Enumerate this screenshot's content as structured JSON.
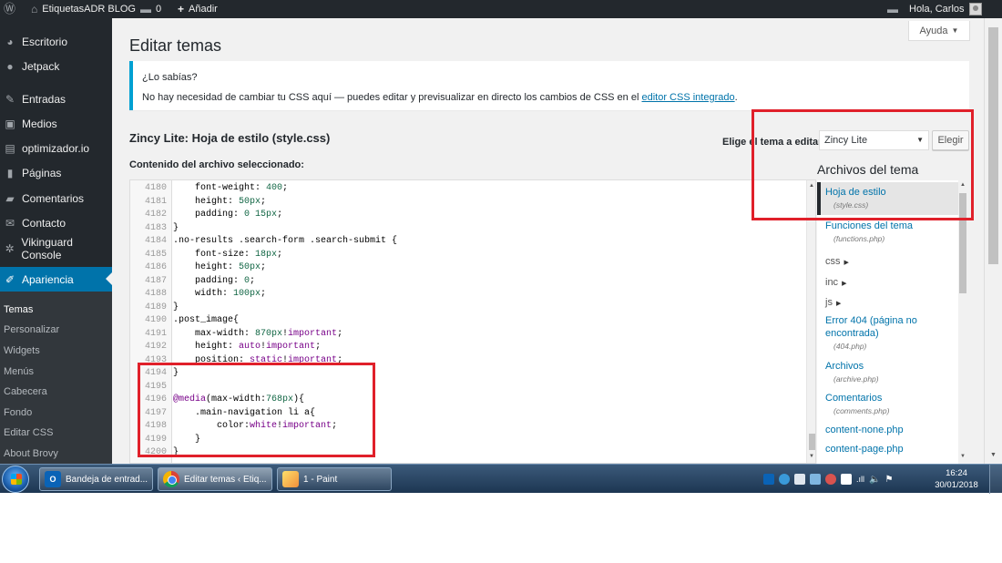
{
  "adminbar": {
    "site_name": "EtiquetasADR BLOG",
    "comments_count": "0",
    "add_label": "Añadir",
    "greeting": "Hola, Carlos"
  },
  "sidebar": {
    "items": [
      {
        "label": "Escritorio",
        "icon": "dashboard-icon"
      },
      {
        "label": "Jetpack",
        "icon": "jetpack-icon"
      },
      {
        "label": "Entradas",
        "icon": "pin-icon"
      },
      {
        "label": "Medios",
        "icon": "media-icon"
      },
      {
        "label": "optimizador.io",
        "icon": "optimizer-icon"
      },
      {
        "label": "Páginas",
        "icon": "pages-icon"
      },
      {
        "label": "Comentarios",
        "icon": "comments-icon"
      },
      {
        "label": "Contacto",
        "icon": "mail-icon"
      },
      {
        "label": "Vikinguard Console",
        "icon": "gear-icon"
      },
      {
        "label": "Apariencia",
        "icon": "brush-icon"
      }
    ],
    "submenu": [
      "Temas",
      "Personalizar",
      "Widgets",
      "Menús",
      "Cabecera",
      "Fondo",
      "Editar CSS",
      "About Brovy"
    ]
  },
  "main": {
    "help_label": "Ayuda",
    "title": "Editar temas",
    "notice": {
      "title": "¿Lo sabías?",
      "text": "No hay necesidad de cambiar tu CSS aquí — puedes editar y previsualizar en directo los cambios de CSS en el ",
      "link": "editor CSS integrado",
      "end": "."
    },
    "file_heading": "Zincy Lite: Hoja de estilo (style.css)",
    "select_label": "Elige el tema a editar:",
    "selected_theme": "Zincy Lite",
    "choose_button": "Elegir",
    "content_label": "Contenido del archivo seleccionado:"
  },
  "editor": {
    "lines": [
      {
        "n": "4180",
        "t": "    font-weight: 400;"
      },
      {
        "n": "4181",
        "t": "    height: 50px;"
      },
      {
        "n": "4182",
        "t": "    padding: 0 15px;"
      },
      {
        "n": "4183",
        "t": "}"
      },
      {
        "n": "4184",
        "t": ".no-results .search-form .search-submit {"
      },
      {
        "n": "4185",
        "t": "    font-size: 18px;"
      },
      {
        "n": "4186",
        "t": "    height: 50px;"
      },
      {
        "n": "4187",
        "t": "    padding: 0;"
      },
      {
        "n": "4188",
        "t": "    width: 100px;"
      },
      {
        "n": "4189",
        "t": "}"
      },
      {
        "n": "4190",
        "t": ".post_image{"
      },
      {
        "n": "4191",
        "t": "    max-width: 870px!important;"
      },
      {
        "n": "4192",
        "t": "    height: auto!important;"
      },
      {
        "n": "4193",
        "t": "    position: static!important;"
      },
      {
        "n": "4194",
        "t": "}"
      },
      {
        "n": "4195",
        "t": ""
      },
      {
        "n": "4196",
        "t": "@media(max-width:768px){"
      },
      {
        "n": "4197",
        "t": "    .main-navigation li a{"
      },
      {
        "n": "4198",
        "t": "        color:white!important;"
      },
      {
        "n": "4199",
        "t": "    }"
      },
      {
        "n": "4200",
        "t": "}"
      }
    ]
  },
  "files": {
    "title": "Archivos del tema",
    "items": [
      {
        "label": "Hoja de estilo",
        "file": "(style.css)",
        "type": "file"
      },
      {
        "label": "Funciones del tema",
        "file": "(functions.php)",
        "type": "file"
      },
      {
        "label": "css",
        "type": "folder"
      },
      {
        "label": "inc",
        "type": "folder"
      },
      {
        "label": "js",
        "type": "folder"
      },
      {
        "label": "Error 404 (página no encontrada)",
        "file": "(404.php)",
        "type": "file"
      },
      {
        "label": "Archivos",
        "file": "(archive.php)",
        "type": "file"
      },
      {
        "label": "Comentarios",
        "file": "(comments.php)",
        "type": "file"
      },
      {
        "label": "content-none.php",
        "type": "file"
      },
      {
        "label": "content-page.php",
        "type": "file"
      }
    ]
  },
  "taskbar": {
    "buttons": [
      "Bandeja de entrad...",
      "Editar temas ‹ Etiq...",
      "1 - Paint"
    ],
    "time": "16:24",
    "date": "30/01/2018"
  },
  "colors": {
    "admin_dark": "#23282d",
    "wp_blue": "#0073aa",
    "notice_blue": "#00a0d2",
    "annotation_red": "#e0202a"
  }
}
